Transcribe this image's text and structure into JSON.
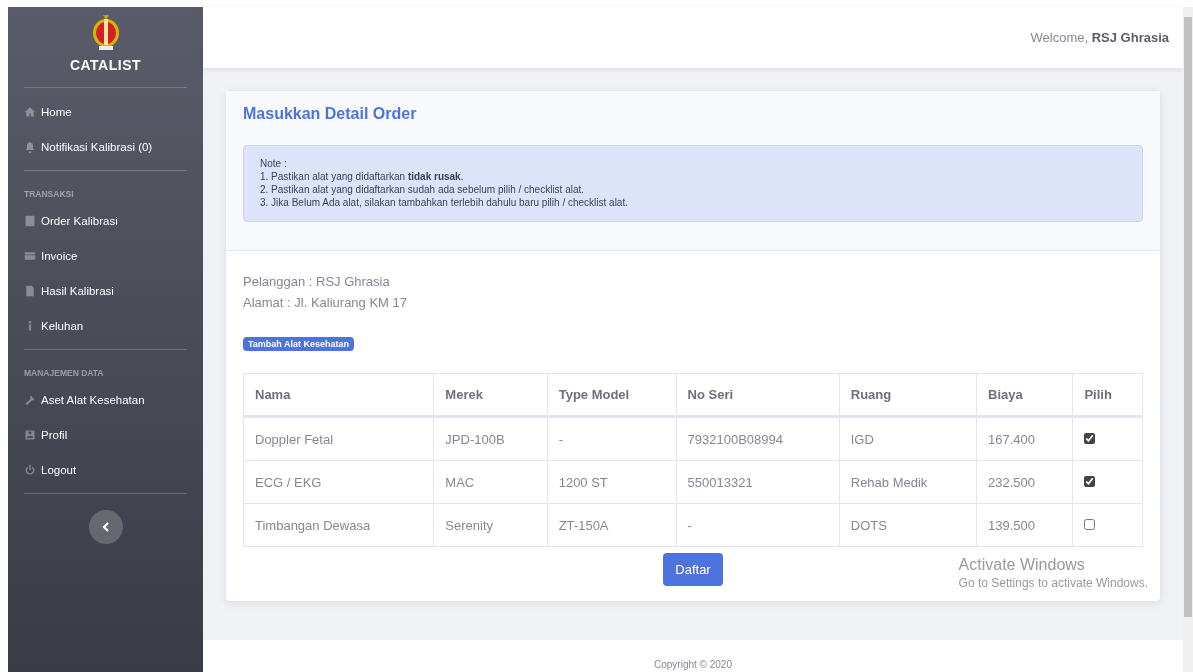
{
  "sidebar": {
    "brand": "CATALIST",
    "groups": [
      {
        "items": [
          {
            "label": "Home"
          },
          {
            "label": "Notifikasi Kalibrasi (0)"
          }
        ]
      },
      {
        "heading": "TRANSAKSI",
        "items": [
          {
            "label": "Order Kalibrasi"
          },
          {
            "label": "Invoice"
          },
          {
            "label": "Hasil Kalibrasi"
          },
          {
            "label": "Keluhan"
          }
        ]
      },
      {
        "heading": "MANAJEMEN DATA",
        "items": [
          {
            "label": "Aset Alat Kesehatan"
          },
          {
            "label": "Profil"
          },
          {
            "label": "Logout"
          }
        ]
      }
    ]
  },
  "topbar": {
    "welcome": "Welcome, **RSJ Ghrasia**"
  },
  "card": {
    "title": "Masukkan Detail Order",
    "note": {
      "heading": "Note :",
      "lines": [
        "1. Pastikan alat yang didaftarkan **tidak rusak**.",
        "2. Pastikan alat yang didaftarkan sudah ada sebelum pilih / checklist alat.",
        "3. Jika Belum Ada alat, silakan tambahkan terlebih dahulu baru pilih / checklist alat."
      ]
    },
    "customer": "Pelanggan : RSJ Ghrasia",
    "address": "Alamat : Jl. Kaliurang KM 17",
    "add_button": "Tambah Alat Kesehatan",
    "table": {
      "columns": [
        "Nama",
        "Merek",
        "Type Model",
        "No Seri",
        "Ruang",
        "Biaya",
        "Pilih"
      ],
      "rows": [
        {
          "cells": [
            "Doppler Fetal",
            "JPD-100B",
            "-",
            "7932100B08994",
            "IGD",
            "167.400"
          ],
          "checked": true
        },
        {
          "cells": [
            "ECG / EKG",
            "MAC",
            "1200 ST",
            "550013321",
            "Rehab Medik",
            "232.500"
          ],
          "checked": true
        },
        {
          "cells": [
            "Timbangan Dewasa",
            "Serenity",
            "ZT-150A",
            "-",
            "DOTS",
            "139.500"
          ],
          "checked": false
        }
      ]
    },
    "submit_button": "Daftar"
  },
  "os_overlay": {
    "title": "Activate Windows",
    "subtitle": "Go to Settings to activate Windows."
  },
  "footer": {
    "copyright": "Copyright © 2020"
  }
}
